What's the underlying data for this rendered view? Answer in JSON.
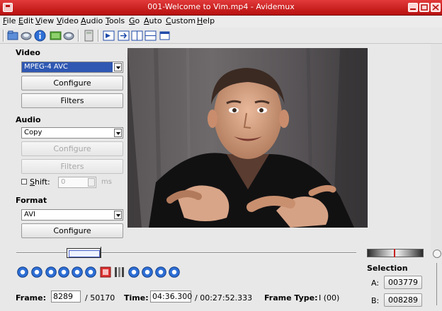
{
  "window": {
    "title": "001-Welcome to Vim.mp4 - Avidemux"
  },
  "menu": [
    {
      "label": "File"
    },
    {
      "label": "Edit"
    },
    {
      "label": "View"
    },
    {
      "label": "Video"
    },
    {
      "label": "Audio"
    },
    {
      "label": "Tools"
    },
    {
      "label": "Go"
    },
    {
      "label": "Auto"
    },
    {
      "label": "Custom"
    },
    {
      "label": "Help"
    }
  ],
  "toolbar": {
    "icons": [
      "open-icon",
      "save-icon",
      "info-icon",
      "save-video-icon",
      "save-audio-icon",
      "calculator-icon",
      "play-filtered-icon",
      "output-preview-icon",
      "side-by-side-icon",
      "stacked-view-icon",
      "window-icon"
    ]
  },
  "video": {
    "section_label": "Video",
    "codec": "MPEG-4 AVC",
    "configure_label": "Configure",
    "filters_label": "Filters"
  },
  "audio": {
    "section_label": "Audio",
    "codec": "Copy",
    "configure_label": "Configure",
    "filters_label": "Filters",
    "shift_label": "Shift:",
    "shift_value": "0",
    "shift_unit": "ms"
  },
  "format": {
    "section_label": "Format",
    "container": "AVI",
    "configure_label": "Configure"
  },
  "selection": {
    "label": "Selection",
    "a_label": "A:",
    "a_value": "003779",
    "b_label": "B:",
    "b_value": "008289"
  },
  "status": {
    "frame_label": "Frame:",
    "frame_value": "8289",
    "frame_total": "/ 50170",
    "time_label": "Time:",
    "time_value": "04:36.300",
    "time_total": "/ 00:27:52.333",
    "frame_type_label": "Frame Type:",
    "frame_type_value": "I (00)"
  },
  "playback": {
    "position": 0.165,
    "buttons": [
      "play-icon",
      "stop-icon",
      "previous-frame-icon",
      "next-frame-icon",
      "previous-keyframe-icon",
      "next-keyframe-icon",
      "set-marker-a-icon",
      "set-marker-b-icon",
      "previous-black-frame-icon",
      "next-black-frame-icon",
      "goto-first-frame-icon",
      "goto-last-frame-icon"
    ]
  },
  "colors": {
    "titlebar": "#c81e1e",
    "accent_blue": "#2f58b2",
    "playback_blue": "#2e6fd6"
  }
}
